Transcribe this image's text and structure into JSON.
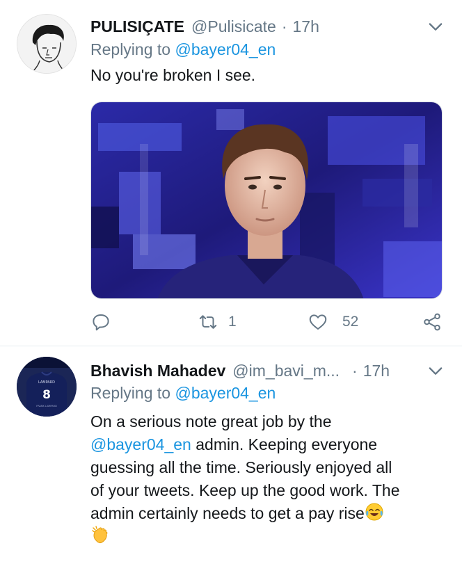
{
  "tweets": [
    {
      "name": "PULISIÇATE",
      "handle": "@Pulisicate",
      "separator": "·",
      "time": "17h",
      "replying_prefix": "Replying to",
      "replying_to": "@bayer04_en",
      "text": "No you're broken I see.",
      "actions": {
        "retweets": "1",
        "likes": "52"
      }
    },
    {
      "name": "Bhavish Mahadev",
      "handle": "@im_bavi_m...",
      "separator": "·",
      "time": "17h",
      "replying_prefix": "Replying to",
      "replying_to": "@bayer04_en",
      "text_lines": {
        "line1": "On a serious note great job by the",
        "mention": "@bayer04_en",
        "line2_rest": " admin. Keeping everyone",
        "line3": "guessing all the time. Seriously enjoyed all",
        "line4": "of your tweets. Keep up the good work. The",
        "line5": "admin certainly needs to get a pay rise"
      },
      "emojis": [
        "face-with-tears-of-joy-emoji",
        "clapping-hands-emoji"
      ],
      "avatar_jersey": {
        "name": "LAMPARD",
        "number": "8",
        "caption": "FRANK LAMPARD"
      }
    }
  ],
  "colors": {
    "link": "#1b95e0",
    "muted": "#657786",
    "text": "#14171a",
    "media_accent": "#3a2fd0"
  }
}
